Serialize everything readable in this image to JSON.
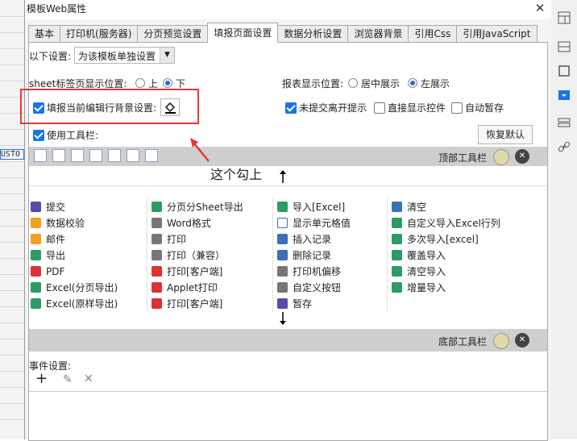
{
  "dialog": {
    "title": "模板Web属性",
    "close_glyph": "✕"
  },
  "tabs": [
    "基本",
    "打印机(服务器)",
    "分页预览设置",
    "填报页面设置",
    "数据分析设置",
    "浏览器背景",
    "引用Css",
    "引用JavaScript"
  ],
  "active_tab_index": 3,
  "settings": {
    "following_label": "以下设置:",
    "following_select": "为该模板单独设置",
    "sheet_tab_label": "sheet标签页显示位置:",
    "sheet_opt_top": "上",
    "sheet_opt_bottom": "下",
    "report_pos_label": "报表显示位置:",
    "report_opt_center": "居中展示",
    "report_opt_left": "左展示",
    "fill_bg_label": "填报当前编辑行背景设置:",
    "unsubmitted_label": "未提交离开提示",
    "direct_controls_label": "直接显示控件",
    "autosave_label": "自动暂存",
    "use_toolbar_label": "使用工具栏:",
    "restore_default": "恢复默认"
  },
  "annotation": {
    "text": "这个勾上"
  },
  "toolbar": {
    "top_label": "顶部工具栏",
    "bottom_label": "底部工具栏"
  },
  "items": [
    [
      "提交",
      "分页分Sheet导出",
      "导入[Excel]",
      "清空"
    ],
    [
      "数据校验",
      "Word格式",
      "显示单元格值",
      "自定义导入Excel行列"
    ],
    [
      "邮件",
      "打印",
      "插入记录",
      "多次导入[excel]"
    ],
    [
      "导出",
      "打印（兼容）",
      "删除记录",
      "覆盖导入"
    ],
    [
      "PDF",
      "打印[客户端]",
      "打印机偏移",
      "清空导入"
    ],
    [
      "Excel(分页导出)",
      "Applet打印",
      "自定义按钮",
      "增量导入"
    ],
    [
      "Excel(原样导出)",
      "打印[客户端]",
      "暂存",
      ""
    ]
  ],
  "events": {
    "label": "事件设置:",
    "add": "+",
    "edit": "✎",
    "remove": "✕"
  },
  "bg_app": {
    "cell_text": "USTO"
  },
  "colors": {
    "accent": "#1a73e8",
    "annotation": "#e53935",
    "toolbar_bar": "#cfcfcf"
  }
}
